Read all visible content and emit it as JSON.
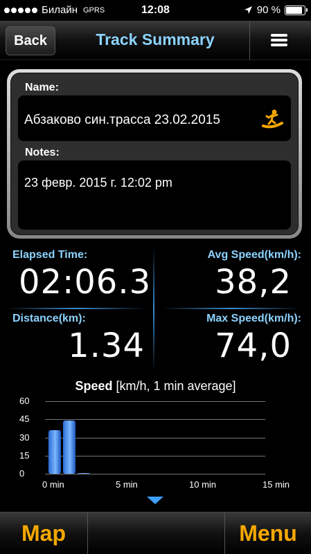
{
  "status_bar": {
    "carrier": "Билайн",
    "network": "GPRS",
    "time": "12:08",
    "battery": "90 %",
    "battery_level": 0.9
  },
  "nav": {
    "back_label": "Back",
    "title": "Track Summary",
    "menu_icon": "hamburger-menu-icon"
  },
  "track": {
    "name_label": "Name:",
    "name_value": "Абзаково син.трасса 23.02.2015",
    "activity_icon": "snowboarder-icon",
    "notes_label": "Notes:",
    "notes_value": "23 февр. 2015 г. 12:02 pm"
  },
  "stats": {
    "elapsed_label": "Elapsed Time:",
    "elapsed_value": "02:06.3",
    "avg_speed_label": "Avg Speed(km/h):",
    "avg_speed_value": "38,2",
    "distance_label": "Distance(km):",
    "distance_value": "1.34",
    "max_speed_label": "Max Speed(km/h):",
    "max_speed_value": "74,0"
  },
  "chart_data": {
    "type": "bar",
    "title": "Speed",
    "subtitle": "[km/h, 1 min average]",
    "x_ticks": [
      "0 min",
      "5 min",
      "10 min",
      "15 min"
    ],
    "y_ticks": [
      "60",
      "45",
      "30",
      "15",
      "0"
    ],
    "ylim": [
      0,
      60
    ],
    "xlim": [
      0,
      15
    ],
    "grid": true,
    "series": [
      {
        "x": [
          0,
          1,
          2
        ],
        "values": [
          36,
          44,
          0.5
        ]
      }
    ],
    "bar_color": "#4a90f0"
  },
  "toolbar": {
    "map_label": "Map",
    "menu_label": "Menu"
  },
  "colors": {
    "accent_blue": "#8cd3ff",
    "orange": "#f6a800"
  }
}
